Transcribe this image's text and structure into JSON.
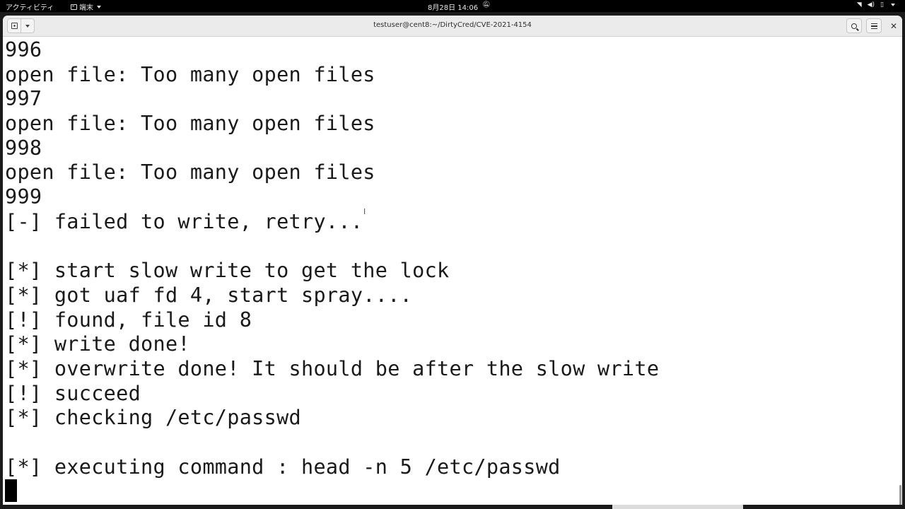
{
  "topbar": {
    "activities": "アクティビティ",
    "app_menu": "端末",
    "clock": "8月28日 14:06"
  },
  "window": {
    "title": "testuser@cent8:~/DirtyCred/CVE-2021-4154"
  },
  "terminal": {
    "lines": [
      "996",
      "open file: Too many open files",
      "997",
      "open file: Too many open files",
      "998",
      "open file: Too many open files",
      "999",
      "[-] failed to write, retry...",
      "",
      "[*] start slow write to get the lock",
      "[*] got uaf fd 4, start spray....",
      "[!] found, file id 8",
      "[*] write done!",
      "[*] overwrite done! It should be after the slow write",
      "[!] succeed",
      "[*] checking /etc/passwd",
      "",
      "[*] executing command : head -n 5 /etc/passwd"
    ]
  },
  "icons": {
    "app_menu": "terminal-icon",
    "new_tab": "new-tab-icon",
    "tab_menu": "chevron-down-icon",
    "search": "search-icon",
    "menu": "hamburger-menu-icon",
    "close": "close-icon",
    "notifications": "bell-muted-icon",
    "network": "wifi-icon",
    "volume": "volume-icon",
    "battery": "battery-icon"
  }
}
